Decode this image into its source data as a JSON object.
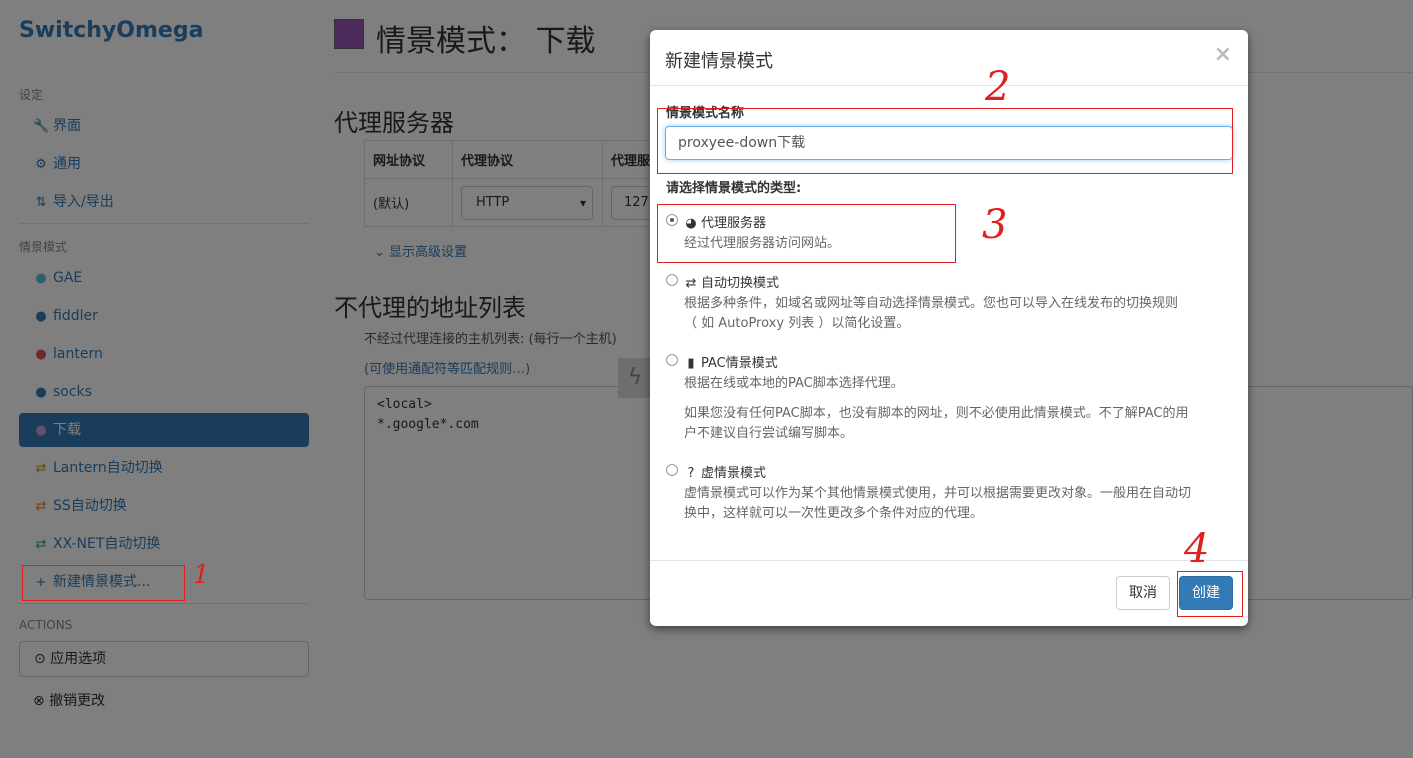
{
  "sidebar": {
    "brand": "SwitchyOmega",
    "settings_header": "设定",
    "settings_items": [
      {
        "icon": "wrench-icon",
        "glyph": "🔧",
        "label": "界面"
      },
      {
        "icon": "gear-icon",
        "glyph": "⚙",
        "label": "通用"
      },
      {
        "icon": "import-export-icon",
        "glyph": "⇅",
        "label": "导入/导出"
      }
    ],
    "profiles_header": "情景模式",
    "profiles": [
      {
        "icon": "globe-icon",
        "glyph": "●",
        "color": "#5bc0de",
        "label": "GAE"
      },
      {
        "icon": "globe-icon",
        "glyph": "●",
        "color": "#337ab7",
        "label": "fiddler"
      },
      {
        "icon": "globe-icon",
        "glyph": "●",
        "color": "#d9534f",
        "label": "lantern"
      },
      {
        "icon": "globe-icon",
        "glyph": "●",
        "color": "#337ab7",
        "label": "socks"
      },
      {
        "icon": "globe-icon",
        "glyph": "●",
        "color": "#9b59b6",
        "label": "下载"
      },
      {
        "icon": "switch-icon",
        "glyph": "⇄",
        "color": "#c8a400",
        "label": "Lantern自动切换"
      },
      {
        "icon": "switch-icon",
        "glyph": "⇄",
        "color": "#e67e22",
        "label": "SS自动切换"
      },
      {
        "icon": "switch-icon",
        "glyph": "⇄",
        "color": "#27ae60",
        "label": "XX-NET自动切换"
      }
    ],
    "new_profile": "新建情景模式...",
    "actions_header": "ACTIONS",
    "apply_label": "应用选项",
    "discard_label": "撤销更改"
  },
  "main": {
    "title": "情景模式： 下载",
    "proxy_section_title": "代理服务器",
    "table_headers": [
      "网址协议",
      "代理协议",
      "代理服"
    ],
    "row_scheme": "(默认)",
    "row_protocol": "HTTP",
    "row_server": "127",
    "advanced_link": "显示高级设置",
    "bypass_title": "不代理的地址列表",
    "bypass_help": "不经过代理连接的主机列表: (每行一个主机)",
    "bypass_link": "(可使用通配符等匹配规则…)",
    "bypass_text": "<local>\n*.google*.com"
  },
  "modal": {
    "title": "新建情景模式",
    "close": "×",
    "name_label": "情景模式名称",
    "name_value": "proxyee-down下载",
    "type_label": "请选择情景模式的类型:",
    "options": [
      {
        "icon": "globe-icon",
        "glyph": "◕",
        "title": "代理服务器",
        "desc": [
          "经过代理服务器访问网站。"
        ],
        "selected": true
      },
      {
        "icon": "switch-icon",
        "glyph": "⇄",
        "title": "自动切换模式",
        "desc": [
          "根据多种条件，如域名或网址等自动选择情景模式。您也可以导入在线发布的切换规则",
          "（ 如 AutoProxy 列表 ）以简化设置。"
        ],
        "selected": false
      },
      {
        "icon": "file-icon",
        "glyph": "▮",
        "title": "PAC情景模式",
        "desc": [
          "根据在线或本地的PAC脚本选择代理。"
        ],
        "desc2": [
          "如果您没有任何PAC脚本，也没有脚本的网址，则不必使用此情景模式。不了解PAC的用",
          "户不建议自行尝试编写脚本。"
        ],
        "selected": false
      },
      {
        "icon": "question-icon",
        "glyph": "?",
        "title": "虚情景模式",
        "desc": [
          "虚情景模式可以作为某个其他情景模式使用，并可以根据需要更改对象。一般用在自动切",
          "换中，这样就可以一次性更改多个条件对应的代理。"
        ],
        "selected": false
      }
    ],
    "cancel_label": "取消",
    "create_label": "创建"
  },
  "annotations": [
    "1",
    "2",
    "3",
    "4"
  ],
  "colors": {
    "accent": "#337ab7",
    "annotation_red": "#e0201f",
    "profile_swatch": "#9b59b6"
  }
}
